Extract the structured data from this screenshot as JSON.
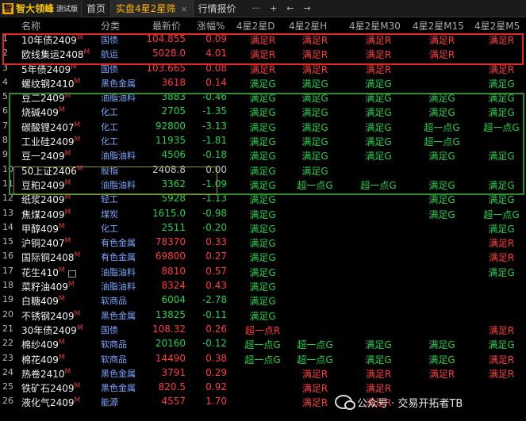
{
  "app": {
    "logo_mark": "智",
    "title": "智大领峰",
    "badge": "测试版"
  },
  "tabs": [
    {
      "label": "首页"
    },
    {
      "label": "实盘4星2星筛",
      "close": "×"
    },
    {
      "label": "行情报价"
    }
  ],
  "toolbar": {
    "more": "···",
    "add": "+",
    "back": "←",
    "forward": "→"
  },
  "columns": {
    "name": "名称",
    "category": "分类",
    "price": "最新价",
    "change": "涨幅%",
    "d": "4星2星D",
    "h": "4星2星H",
    "m30": "4星2星M30",
    "m15": "4星2星M15",
    "m5": "4星2星M5"
  },
  "rows": [
    {
      "idx": "1",
      "name": "10年债2409",
      "sup": "M",
      "cat": "国债",
      "price": "104.855",
      "pct": "0.09",
      "d": "满足R",
      "h": "满足R",
      "m30": "满足R",
      "m15": "满足R",
      "m5": "满足R"
    },
    {
      "idx": "2",
      "name": "欧线集运2408",
      "sup": "M",
      "cat": "航运",
      "price": "5028.0",
      "pct": "4.01",
      "d": "满足R",
      "h": "满足R",
      "m30": "满足R",
      "m15": "满足R",
      "m5": ""
    },
    {
      "idx": "3",
      "name": "5年债2409",
      "sup": "M",
      "cat": "国债",
      "price": "103.665",
      "pct": "0.08",
      "d": "满足R",
      "h": "满足R",
      "m30": "满足R",
      "m15": "",
      "m5": "满足R"
    },
    {
      "idx": "4",
      "name": "螺纹钢2410",
      "sup": "M",
      "cat": "黑色金属",
      "price": "3618",
      "pct": "0.14",
      "d": "满足G",
      "h": "满足G",
      "m30": "满足G",
      "m15": "",
      "m5": "满足G"
    },
    {
      "idx": "5",
      "name": "豆二2409",
      "sup": "M",
      "cat": "油脂油料",
      "price": "3883",
      "pct": "-0.46",
      "d": "满足G",
      "h": "满足G",
      "m30": "满足G",
      "m15": "满足G",
      "m5": "满足G"
    },
    {
      "idx": "6",
      "name": "烧碱409",
      "sup": "M",
      "cat": "化工",
      "price": "2705",
      "pct": "-1.35",
      "d": "满足G",
      "h": "满足G",
      "m30": "满足G",
      "m15": "满足G",
      "m5": "满足G"
    },
    {
      "idx": "7",
      "name": "碳酸锂2407",
      "sup": "M",
      "cat": "化工",
      "price": "92800",
      "pct": "-3.13",
      "d": "满足G",
      "h": "满足G",
      "m30": "满足G",
      "m15": "超一点G",
      "m5": "超一点G"
    },
    {
      "idx": "8",
      "name": "工业硅2409",
      "sup": "M",
      "cat": "化工",
      "price": "11935",
      "pct": "-1.81",
      "d": "满足G",
      "h": "满足G",
      "m30": "满足G",
      "m15": "超一点G",
      "m5": ""
    },
    {
      "idx": "9",
      "name": "豆一2409",
      "sup": "M",
      "cat": "油脂油料",
      "price": "4506",
      "pct": "-0.18",
      "d": "满足G",
      "h": "满足G",
      "m30": "满足G",
      "m15": "满足G",
      "m5": "满足G"
    },
    {
      "idx": "10",
      "name": "50上证2406",
      "sup": "M",
      "cat": "股指",
      "price": "2408.8",
      "pct": "0.00",
      "d": "满足G",
      "h": "满足G",
      "m30": "",
      "m15": "",
      "m5": ""
    },
    {
      "idx": "11",
      "name": "豆粕2409",
      "sup": "M",
      "cat": "油脂油料",
      "price": "3362",
      "pct": "-1.09",
      "d": "满足G",
      "h": "超一点G",
      "m30": "超一点G",
      "m15": "满足G",
      "m5": "满足G"
    },
    {
      "idx": "12",
      "name": "纸浆2409",
      "sup": "M",
      "cat": "轻工",
      "price": "5928",
      "pct": "-1.13",
      "d": "满足G",
      "h": "",
      "m30": "",
      "m15": "满足G",
      "m5": "满足G"
    },
    {
      "idx": "13",
      "name": "焦煤2409",
      "sup": "M",
      "cat": "煤炭",
      "price": "1615.0",
      "pct": "-0.98",
      "d": "满足G",
      "h": "",
      "m30": "",
      "m15": "满足G",
      "m5": "超一点G"
    },
    {
      "idx": "14",
      "name": "甲醇409",
      "sup": "M",
      "cat": "化工",
      "price": "2511",
      "pct": "-0.20",
      "d": "满足G",
      "h": "",
      "m30": "",
      "m15": "",
      "m5": "满足G"
    },
    {
      "idx": "15",
      "name": "沪铜2407",
      "sup": "M",
      "cat": "有色金属",
      "price": "78370",
      "pct": "0.33",
      "d": "满足G",
      "h": "",
      "m30": "",
      "m15": "",
      "m5": "满足R"
    },
    {
      "idx": "16",
      "name": "国际铜2408",
      "sup": "M",
      "cat": "有色金属",
      "price": "69800",
      "pct": "0.27",
      "d": "满足G",
      "h": "",
      "m30": "",
      "m15": "",
      "m5": "满足R"
    },
    {
      "idx": "17",
      "name": "花生410",
      "sup": "M",
      "cat": "油脂油料",
      "price": "8810",
      "pct": "0.57",
      "d": "满足G",
      "h": "",
      "m30": "",
      "m15": "",
      "m5": "满足G",
      "chart_icon": true
    },
    {
      "idx": "18",
      "name": "菜籽油409",
      "sup": "M",
      "cat": "油脂油料",
      "price": "8324",
      "pct": "0.43",
      "d": "满足G",
      "h": "",
      "m30": "",
      "m15": "",
      "m5": ""
    },
    {
      "idx": "19",
      "name": "白糖409",
      "sup": "M",
      "cat": "软商品",
      "price": "6004",
      "pct": "-2.78",
      "d": "满足G",
      "h": "",
      "m30": "",
      "m15": "",
      "m5": ""
    },
    {
      "idx": "20",
      "name": "不锈钢2409",
      "sup": "M",
      "cat": "黑色金属",
      "price": "13825",
      "pct": "-0.11",
      "d": "满足G",
      "h": "",
      "m30": "",
      "m15": "",
      "m5": ""
    },
    {
      "idx": "21",
      "name": "30年债2409",
      "sup": "M",
      "cat": "国债",
      "price": "108.32",
      "pct": "0.26",
      "d": "超一点R",
      "h": "",
      "m30": "",
      "m15": "",
      "m5": "满足R"
    },
    {
      "idx": "22",
      "name": "棉纱409",
      "sup": "M",
      "cat": "软商品",
      "price": "20160",
      "pct": "-0.12",
      "d": "超一点G",
      "h": "超一点G",
      "m30": "满足G",
      "m15": "满足G",
      "m5": "满足G"
    },
    {
      "idx": "23",
      "name": "棉花409",
      "sup": "M",
      "cat": "软商品",
      "price": "14490",
      "pct": "0.38",
      "d": "超一点G",
      "h": "超一点G",
      "m30": "满足G",
      "m15": "满足G",
      "m5": "满足R"
    },
    {
      "idx": "24",
      "name": "热卷2410",
      "sup": "M",
      "cat": "黑色金属",
      "price": "3791",
      "pct": "0.29",
      "d": "",
      "h": "满足R",
      "m30": "满足R",
      "m15": "满足R",
      "m5": "满足R"
    },
    {
      "idx": "25",
      "name": "铁矿石2409",
      "sup": "M",
      "cat": "黑色金属",
      "price": "820.5",
      "pct": "0.92",
      "d": "",
      "h": "满足R",
      "m30": "满足R",
      "m15": "",
      "m5": ""
    },
    {
      "idx": "26",
      "name": "液化气2409",
      "sup": "M",
      "cat": "能源",
      "price": "4557",
      "pct": "1.70",
      "d": "",
      "h": "满足R",
      "m30": "满足R",
      "m15": "",
      "m5": ""
    }
  ],
  "watermark": {
    "text": "公众号 · 交易开拓者TB"
  }
}
